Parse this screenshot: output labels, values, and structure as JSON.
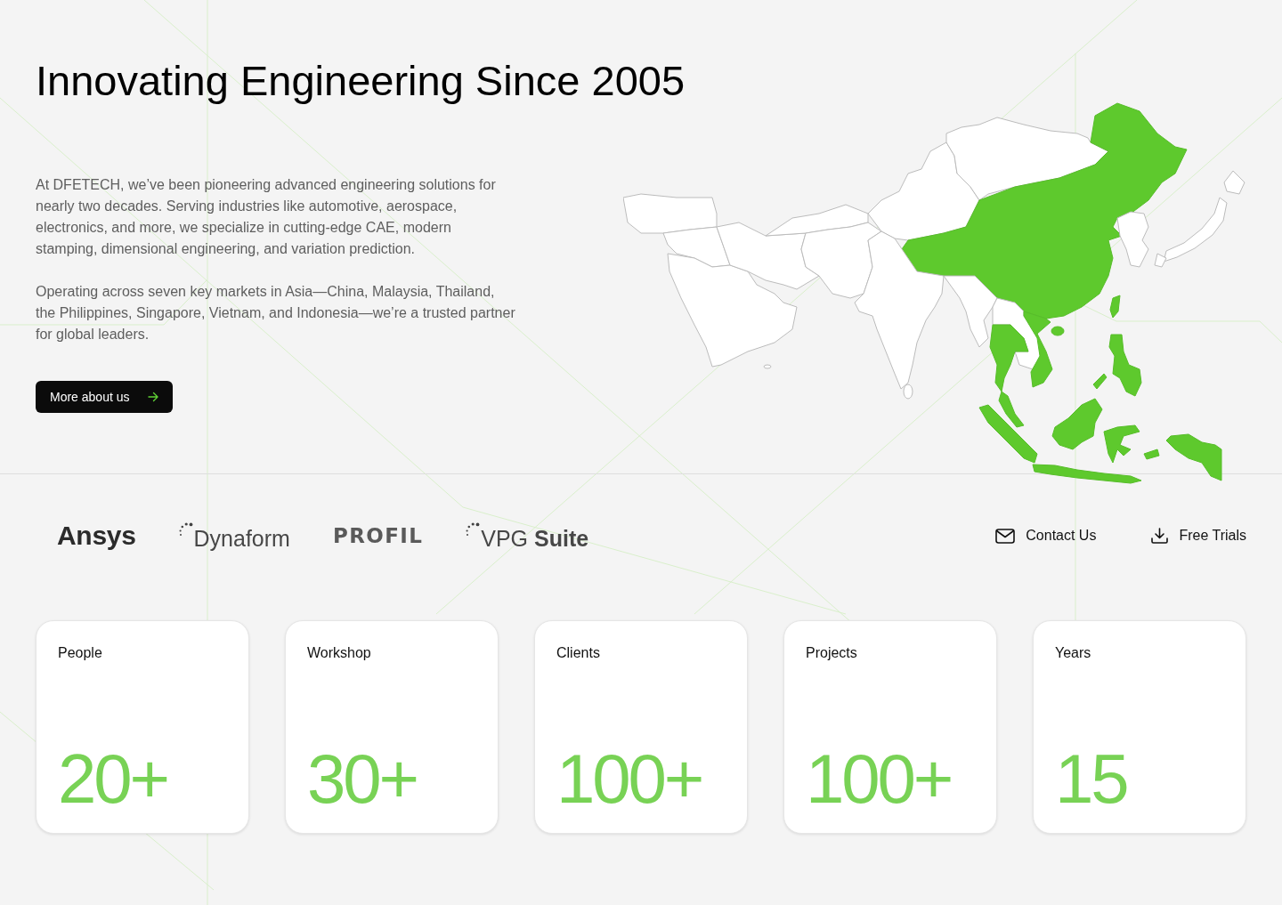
{
  "hero": {
    "title": "Innovating Engineering Since 2005",
    "paragraphs": [
      "At DFETECH, we’ve been pioneering advanced engineering solutions for nearly two decades. Serving industries like automotive, aerospace, electronics, and more, we specialize in cutting-edge CAE, modern stamping, dimensional engineering, and variation prediction.",
      "Operating across seven key markets in Asia—China, Malaysia, Thailand, the Philippines, Singapore, Vietnam, and Indonesia—we’re a trusted partner for global leaders."
    ],
    "button": {
      "label": "More about us"
    }
  },
  "partners": [
    {
      "name": "Ansys",
      "kind": "bold"
    },
    {
      "name": "Dynaform",
      "kind": "dots"
    },
    {
      "name": "PROFIL",
      "kind": "heavy"
    },
    {
      "name": "VPG **Suite**",
      "kind": "dots"
    }
  ],
  "actions": [
    {
      "label": "Contact Us",
      "kind": "mail"
    },
    {
      "label": "Free Trials",
      "kind": "download"
    }
  ],
  "stats": [
    {
      "label": "People",
      "value": "20+"
    },
    {
      "label": "Workshop",
      "value": "30+"
    },
    {
      "label": "Clients",
      "value": "100+"
    },
    {
      "label": "Projects",
      "value": "100+"
    },
    {
      "label": "Years",
      "value": "15"
    }
  ]
}
